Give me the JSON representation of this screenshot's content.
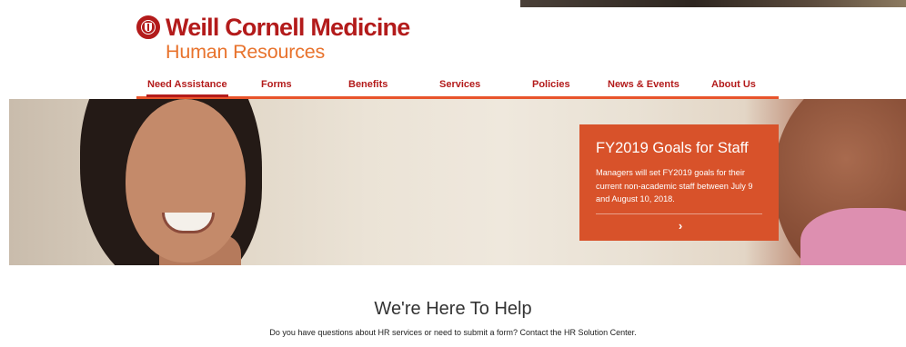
{
  "logo": {
    "title": "Weill Cornell Medicine",
    "subtitle": "Human Resources"
  },
  "nav": {
    "items": [
      {
        "label": "Need Assistance"
      },
      {
        "label": "Forms"
      },
      {
        "label": "Benefits"
      },
      {
        "label": "Services"
      },
      {
        "label": "Policies"
      },
      {
        "label": "News & Events"
      },
      {
        "label": "About Us"
      }
    ]
  },
  "hero": {
    "callout": {
      "title": "FY2019 Goals for Staff",
      "body": "Managers will set FY2019 goals for their current non-academic staff between July 9 and August 10, 2018.",
      "arrow": "›"
    }
  },
  "help": {
    "heading": "We're Here To Help",
    "text": "Do you have questions about HR services or need to submit a form? Contact the HR Solution Center."
  },
  "colors": {
    "brand_red": "#b31b1b",
    "brand_orange": "#e8732d",
    "nav_rule": "#e8542b",
    "callout_bg": "#d8522a"
  },
  "icons": {
    "logo_seal": "seal-icon",
    "callout_arrow": "chevron-right-icon"
  }
}
